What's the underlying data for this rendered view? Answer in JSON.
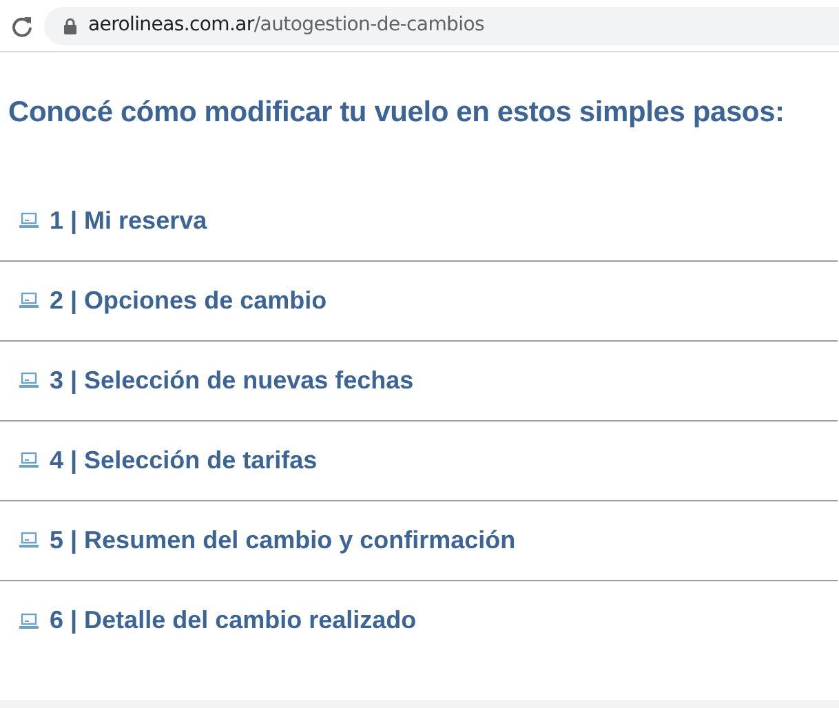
{
  "address_bar": {
    "host": "aerolineas.com.ar",
    "path": "/autogestion-de-cambios"
  },
  "heading": "Conocé cómo modificar tu vuelo en estos simples pasos:",
  "steps": [
    {
      "label": "1 | Mi reserva"
    },
    {
      "label": "2 | Opciones de cambio"
    },
    {
      "label": "3 | Selección de nuevas fechas"
    },
    {
      "label": "4 | Selección de tarifas"
    },
    {
      "label": "5 | Resumen del cambio y confirmación"
    },
    {
      "label": "6 | Detalle del cambio realizado"
    }
  ]
}
